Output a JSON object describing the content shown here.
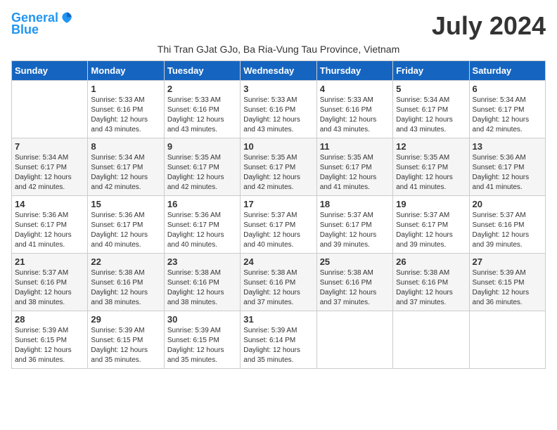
{
  "header": {
    "logo_line1": "General",
    "logo_line2": "Blue",
    "month_title": "July 2024",
    "subtitle": "Thi Tran GJat GJo, Ba Ria-Vung Tau Province, Vietnam"
  },
  "columns": [
    "Sunday",
    "Monday",
    "Tuesday",
    "Wednesday",
    "Thursday",
    "Friday",
    "Saturday"
  ],
  "weeks": [
    [
      {
        "day": "",
        "sunrise": "",
        "sunset": "",
        "daylight": ""
      },
      {
        "day": "1",
        "sunrise": "Sunrise: 5:33 AM",
        "sunset": "Sunset: 6:16 PM",
        "daylight": "Daylight: 12 hours and 43 minutes."
      },
      {
        "day": "2",
        "sunrise": "Sunrise: 5:33 AM",
        "sunset": "Sunset: 6:16 PM",
        "daylight": "Daylight: 12 hours and 43 minutes."
      },
      {
        "day": "3",
        "sunrise": "Sunrise: 5:33 AM",
        "sunset": "Sunset: 6:16 PM",
        "daylight": "Daylight: 12 hours and 43 minutes."
      },
      {
        "day": "4",
        "sunrise": "Sunrise: 5:33 AM",
        "sunset": "Sunset: 6:16 PM",
        "daylight": "Daylight: 12 hours and 43 minutes."
      },
      {
        "day": "5",
        "sunrise": "Sunrise: 5:34 AM",
        "sunset": "Sunset: 6:17 PM",
        "daylight": "Daylight: 12 hours and 43 minutes."
      },
      {
        "day": "6",
        "sunrise": "Sunrise: 5:34 AM",
        "sunset": "Sunset: 6:17 PM",
        "daylight": "Daylight: 12 hours and 42 minutes."
      }
    ],
    [
      {
        "day": "7",
        "sunrise": "Sunrise: 5:34 AM",
        "sunset": "Sunset: 6:17 PM",
        "daylight": "Daylight: 12 hours and 42 minutes."
      },
      {
        "day": "8",
        "sunrise": "Sunrise: 5:34 AM",
        "sunset": "Sunset: 6:17 PM",
        "daylight": "Daylight: 12 hours and 42 minutes."
      },
      {
        "day": "9",
        "sunrise": "Sunrise: 5:35 AM",
        "sunset": "Sunset: 6:17 PM",
        "daylight": "Daylight: 12 hours and 42 minutes."
      },
      {
        "day": "10",
        "sunrise": "Sunrise: 5:35 AM",
        "sunset": "Sunset: 6:17 PM",
        "daylight": "Daylight: 12 hours and 42 minutes."
      },
      {
        "day": "11",
        "sunrise": "Sunrise: 5:35 AM",
        "sunset": "Sunset: 6:17 PM",
        "daylight": "Daylight: 12 hours and 41 minutes."
      },
      {
        "day": "12",
        "sunrise": "Sunrise: 5:35 AM",
        "sunset": "Sunset: 6:17 PM",
        "daylight": "Daylight: 12 hours and 41 minutes."
      },
      {
        "day": "13",
        "sunrise": "Sunrise: 5:36 AM",
        "sunset": "Sunset: 6:17 PM",
        "daylight": "Daylight: 12 hours and 41 minutes."
      }
    ],
    [
      {
        "day": "14",
        "sunrise": "Sunrise: 5:36 AM",
        "sunset": "Sunset: 6:17 PM",
        "daylight": "Daylight: 12 hours and 41 minutes."
      },
      {
        "day": "15",
        "sunrise": "Sunrise: 5:36 AM",
        "sunset": "Sunset: 6:17 PM",
        "daylight": "Daylight: 12 hours and 40 minutes."
      },
      {
        "day": "16",
        "sunrise": "Sunrise: 5:36 AM",
        "sunset": "Sunset: 6:17 PM",
        "daylight": "Daylight: 12 hours and 40 minutes."
      },
      {
        "day": "17",
        "sunrise": "Sunrise: 5:37 AM",
        "sunset": "Sunset: 6:17 PM",
        "daylight": "Daylight: 12 hours and 40 minutes."
      },
      {
        "day": "18",
        "sunrise": "Sunrise: 5:37 AM",
        "sunset": "Sunset: 6:17 PM",
        "daylight": "Daylight: 12 hours and 39 minutes."
      },
      {
        "day": "19",
        "sunrise": "Sunrise: 5:37 AM",
        "sunset": "Sunset: 6:17 PM",
        "daylight": "Daylight: 12 hours and 39 minutes."
      },
      {
        "day": "20",
        "sunrise": "Sunrise: 5:37 AM",
        "sunset": "Sunset: 6:16 PM",
        "daylight": "Daylight: 12 hours and 39 minutes."
      }
    ],
    [
      {
        "day": "21",
        "sunrise": "Sunrise: 5:37 AM",
        "sunset": "Sunset: 6:16 PM",
        "daylight": "Daylight: 12 hours and 38 minutes."
      },
      {
        "day": "22",
        "sunrise": "Sunrise: 5:38 AM",
        "sunset": "Sunset: 6:16 PM",
        "daylight": "Daylight: 12 hours and 38 minutes."
      },
      {
        "day": "23",
        "sunrise": "Sunrise: 5:38 AM",
        "sunset": "Sunset: 6:16 PM",
        "daylight": "Daylight: 12 hours and 38 minutes."
      },
      {
        "day": "24",
        "sunrise": "Sunrise: 5:38 AM",
        "sunset": "Sunset: 6:16 PM",
        "daylight": "Daylight: 12 hours and 37 minutes."
      },
      {
        "day": "25",
        "sunrise": "Sunrise: 5:38 AM",
        "sunset": "Sunset: 6:16 PM",
        "daylight": "Daylight: 12 hours and 37 minutes."
      },
      {
        "day": "26",
        "sunrise": "Sunrise: 5:38 AM",
        "sunset": "Sunset: 6:16 PM",
        "daylight": "Daylight: 12 hours and 37 minutes."
      },
      {
        "day": "27",
        "sunrise": "Sunrise: 5:39 AM",
        "sunset": "Sunset: 6:15 PM",
        "daylight": "Daylight: 12 hours and 36 minutes."
      }
    ],
    [
      {
        "day": "28",
        "sunrise": "Sunrise: 5:39 AM",
        "sunset": "Sunset: 6:15 PM",
        "daylight": "Daylight: 12 hours and 36 minutes."
      },
      {
        "day": "29",
        "sunrise": "Sunrise: 5:39 AM",
        "sunset": "Sunset: 6:15 PM",
        "daylight": "Daylight: 12 hours and 35 minutes."
      },
      {
        "day": "30",
        "sunrise": "Sunrise: 5:39 AM",
        "sunset": "Sunset: 6:15 PM",
        "daylight": "Daylight: 12 hours and 35 minutes."
      },
      {
        "day": "31",
        "sunrise": "Sunrise: 5:39 AM",
        "sunset": "Sunset: 6:14 PM",
        "daylight": "Daylight: 12 hours and 35 minutes."
      },
      {
        "day": "",
        "sunrise": "",
        "sunset": "",
        "daylight": ""
      },
      {
        "day": "",
        "sunrise": "",
        "sunset": "",
        "daylight": ""
      },
      {
        "day": "",
        "sunrise": "",
        "sunset": "",
        "daylight": ""
      }
    ]
  ]
}
